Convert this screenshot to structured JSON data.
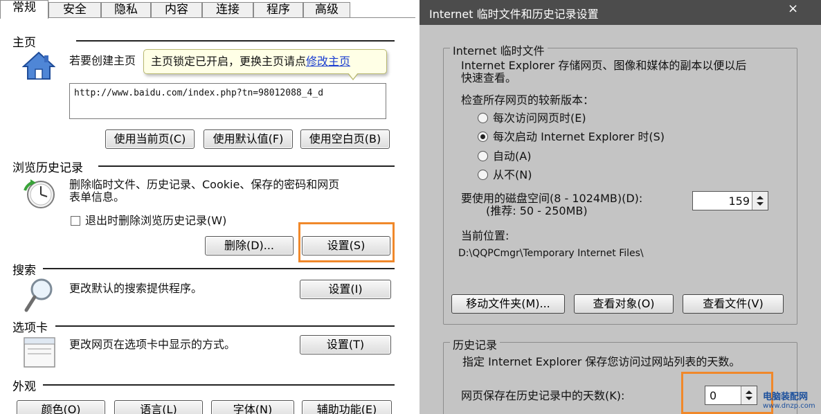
{
  "left": {
    "tabs": [
      "常规",
      "安全",
      "隐私",
      "内容",
      "连接",
      "程序",
      "高级"
    ],
    "home": {
      "title": "主页",
      "desc": "若要创建主页",
      "tooltip_text": "主页锁定已开启，更换主页请点",
      "tooltip_link": "修改主页",
      "url": "http://www.baidu.com/index.php?tn=98012088_4_d",
      "buttons": [
        "使用当前页(C)",
        "使用默认值(F)",
        "使用空白页(B)"
      ]
    },
    "history": {
      "title": "浏览历史记录",
      "desc_line1": "删除临时文件、历史记录、Cookie、保存的密码和网页",
      "desc_line2": "表单信息。",
      "checkbox_label": "退出时删除浏览历史记录(W)",
      "delete_label": "删除(D)...",
      "settings_label": "设置(S)"
    },
    "search": {
      "title": "搜索",
      "desc": "更改默认的搜索提供程序。",
      "settings_label": "设置(I)"
    },
    "tabs_section": {
      "title": "选项卡",
      "desc": "更改网页在选项卡中显示的方式。",
      "settings_label": "设置(T)"
    },
    "appearance": {
      "title": "外观",
      "buttons": [
        "颜色(O)",
        "语言(L)",
        "字体(N)",
        "辅助功能(E)"
      ]
    }
  },
  "right": {
    "title": "Internet 临时文件和历史记录设置",
    "close": "×",
    "temp": {
      "legend": "Internet 临时文件",
      "desc_line1": "Internet Explorer 存储网页、图像和媒体的副本以便以后",
      "desc_line2": "快速查看。",
      "check_label": "检查所存网页的较新版本：",
      "options": [
        "每次访问网页时(E)",
        "每次启动 Internet Explorer 时(S)",
        "自动(A)",
        "从不(N)"
      ],
      "selected_index": 1,
      "disk_label": "要使用的磁盘空间(8 - 1024MB)(D):",
      "disk_hint": "(推荐: 50 - 250MB)",
      "disk_value": "159",
      "location_label": "当前位置:",
      "location_path": "D:\\QQPCmgr\\Temporary Internet Files\\",
      "buttons": [
        "移动文件夹(M)...",
        "查看对象(O)",
        "查看文件(V)"
      ]
    },
    "history": {
      "legend": "历史记录",
      "desc": "指定 Internet Explorer 保存您访问过网站列表的天数。",
      "days_label": "网页保存在历史记录中的天数(K):",
      "days_value": "0"
    }
  },
  "watermark": {
    "line1": "电脑装配网",
    "line2": "www.dnzp.com"
  }
}
